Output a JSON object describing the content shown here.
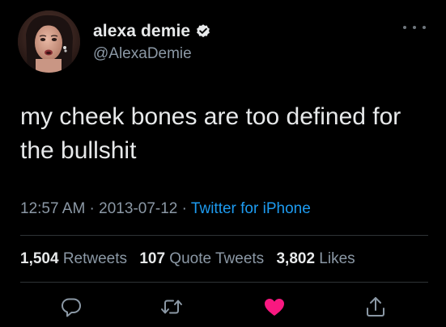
{
  "author": {
    "display_name": "alexa demie",
    "handle": "@AlexaDemie",
    "verified": true,
    "avatar_icon": "profile-photo"
  },
  "tweet": {
    "text_line1": "my cheek bones are too defined for",
    "text_line2": "the bullshit"
  },
  "meta": {
    "time": "12:57 AM",
    "separator": " · ",
    "date": "2013-07-12",
    "source": "Twitter for iPhone"
  },
  "stats": {
    "retweets_count": "1,504",
    "retweets_label": "Retweets",
    "quote_count": "107",
    "quote_label": "Quote Tweets",
    "likes_count": "3,802",
    "likes_label": "Likes"
  },
  "actions": [
    {
      "icon": "reply-icon"
    },
    {
      "icon": "retweet-icon"
    },
    {
      "icon": "like-icon",
      "state": "liked"
    },
    {
      "icon": "share-icon"
    }
  ],
  "colors": {
    "background": "#000000",
    "accent": "#1d9bf0",
    "like": "#f91880",
    "secondary_text": "#8b98a5",
    "primary_text": "#e7e9ea"
  }
}
